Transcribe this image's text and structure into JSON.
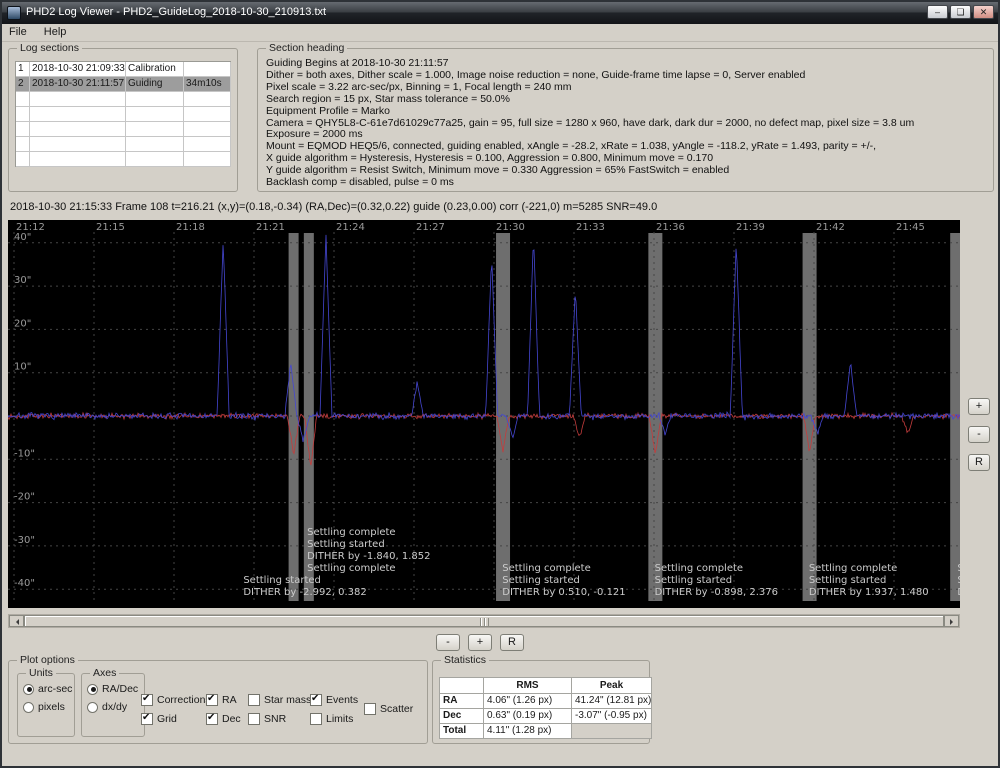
{
  "window": {
    "title": "PHD2 Log Viewer - PHD2_GuideLog_2018-10-30_210913.txt",
    "menu": {
      "file": "File",
      "help": "Help"
    },
    "controls": {
      "minimize": "–",
      "maximize": "❏",
      "close": "✕"
    }
  },
  "log_sections": {
    "label": "Log sections",
    "selected_index": 1,
    "empty_rows": 5,
    "rows": [
      {
        "num": "1",
        "timestamp": "2018-10-30 21:09:33",
        "type": "Calibration",
        "duration": ""
      },
      {
        "num": "2",
        "timestamp": "2018-10-30 21:11:57",
        "type": "Guiding",
        "duration": "34m10s"
      }
    ]
  },
  "section_heading": {
    "label": "Section heading",
    "lines": [
      "Guiding Begins at 2018-10-30 21:11:57",
      "Dither = both axes, Dither scale = 1.000, Image noise reduction = none, Guide-frame time lapse = 0, Server enabled",
      "Pixel scale = 3.22 arc-sec/px, Binning = 1, Focal length = 240 mm",
      "Search region = 15 px, Star mass tolerance = 50.0%",
      "Equipment Profile = Marko",
      "Camera = QHY5L8-C-61e7d61029c77a25, gain = 95, full size = 1280 x 960, have dark, dark dur = 2000, no defect map, pixel size = 3.8 um",
      "Exposure = 2000 ms",
      "Mount = EQMOD HEQ5/6,  connected, guiding enabled, xAngle = -28.2, xRate = 1.038, yAngle = -118.2, yRate = 1.493, parity = +/-,",
      "X guide algorithm = Hysteresis, Hysteresis = 0.100, Aggression = 0.800, Minimum move = 0.170",
      "Y guide algorithm = Resist Switch, Minimum move = 0.330 Aggression = 65% FastSwitch = enabled",
      "Backlash comp = disabled, pulse = 0 ms"
    ]
  },
  "status_line": "2018-10-30 21:15:33 Frame 108 t=216.21 (x,y)=(0.18,-0.34) (RA,Dec)=(0.32,0.22) guide (0.23,0.00) corr (-221,0) m=5285 SNR=49.0",
  "chart_data": {
    "type": "line",
    "title": "",
    "x_ticks": [
      "21:12",
      "21:15",
      "21:18",
      "21:21",
      "21:24",
      "21:27",
      "21:30",
      "21:33",
      "21:36",
      "21:39",
      "21:42",
      "21:45"
    ],
    "y_tick_labels": [
      "40\"",
      "30\"",
      "20\"",
      "10\"",
      "-10\"",
      "-20\"",
      "-30\"",
      "-40\""
    ],
    "y_tick_values": [
      40,
      30,
      20,
      10,
      -10,
      -20,
      -30,
      -40
    ],
    "y_gridlines": [
      40,
      30,
      20,
      10,
      0,
      -10,
      -20,
      -30,
      -40
    ],
    "ylim": [
      -45,
      45
    ],
    "grid": true,
    "background": "#000000",
    "series": [
      {
        "name": "RA",
        "color": "#4547d2"
      },
      {
        "name": "Dec",
        "color": "#c43c3c"
      }
    ],
    "ra_spikes": [
      [
        0.226,
        41
      ],
      [
        0.297,
        12
      ],
      [
        0.31,
        -6
      ],
      [
        0.334,
        42
      ],
      [
        0.43,
        8
      ],
      [
        0.508,
        37
      ],
      [
        0.53,
        -5
      ],
      [
        0.552,
        42
      ],
      [
        0.596,
        29
      ],
      [
        0.69,
        -4
      ],
      [
        0.765,
        41
      ],
      [
        0.85,
        -4
      ],
      [
        0.885,
        13
      ]
    ],
    "dec_dips": [
      [
        0.3,
        -9
      ],
      [
        0.318,
        -12
      ],
      [
        0.52,
        -8
      ],
      [
        0.6,
        -5
      ],
      [
        0.68,
        -9
      ],
      [
        0.842,
        -8
      ],
      [
        0.945,
        -4
      ]
    ],
    "event_bars": [
      [
        0.3,
        10
      ],
      [
        0.316,
        10
      ],
      [
        0.52,
        14
      ],
      [
        0.68,
        14
      ],
      [
        0.842,
        14
      ],
      [
        0.996,
        12
      ]
    ],
    "annotations": [
      {
        "x": 0.243,
        "raise": 0,
        "lines": [
          "Settling started",
          "DITHER by -2.992, 0.382"
        ]
      },
      {
        "x": 0.31,
        "raise": 2,
        "lines": [
          "Settling complete",
          "Settling started",
          "DITHER by -1.840, 1.852",
          "Settling complete"
        ]
      },
      {
        "x": 0.515,
        "raise": 0,
        "lines": [
          "Settling complete",
          "Settling started",
          "DITHER by 0.510, -0.121"
        ]
      },
      {
        "x": 0.675,
        "raise": 0,
        "lines": [
          "Settling complete",
          "Settling started",
          "DITHER by -0.898, 2.376"
        ]
      },
      {
        "x": 0.837,
        "raise": 0,
        "lines": [
          "Settling complete",
          "Settling started",
          "DITHER by 1.937, 1.480"
        ]
      },
      {
        "x": 0.993,
        "raise": 0,
        "lines": [
          "Settling complete",
          "Settling started",
          "DITHER by"
        ]
      }
    ]
  },
  "chart_controls": {
    "side": [
      "+",
      "-",
      "R"
    ],
    "bottom": [
      "-",
      "+",
      "R"
    ]
  },
  "plot_options": {
    "label": "Plot options",
    "units": {
      "label": "Units",
      "options": [
        {
          "label": "arc-sec",
          "selected": true
        },
        {
          "label": "pixels",
          "selected": false
        }
      ]
    },
    "axes": {
      "label": "Axes",
      "options": [
        {
          "label": "RA/Dec",
          "selected": true
        },
        {
          "label": "dx/dy",
          "selected": false
        }
      ]
    },
    "checkboxes": [
      {
        "label": "Corrections",
        "checked": true
      },
      {
        "label": "Grid",
        "checked": true
      },
      {
        "label": "RA",
        "checked": true
      },
      {
        "label": "Dec",
        "checked": true
      },
      {
        "label": "Star mass",
        "checked": false
      },
      {
        "label": "SNR",
        "checked": false
      },
      {
        "label": "Events",
        "checked": true
      },
      {
        "label": "Limits",
        "checked": false
      },
      {
        "label": "Scatter",
        "checked": false
      }
    ]
  },
  "statistics": {
    "label": "Statistics",
    "columns": [
      "",
      "RMS",
      "Peak"
    ],
    "rows": [
      {
        "label": "RA",
        "rms": "4.06\" (1.26 px)",
        "peak": "41.24\" (12.81 px)"
      },
      {
        "label": "Dec",
        "rms": "0.63\" (0.19 px)",
        "peak": "-3.07\" (-0.95 px)"
      },
      {
        "label": "Total",
        "rms": "4.11\" (1.28 px)",
        "peak": ""
      }
    ]
  }
}
